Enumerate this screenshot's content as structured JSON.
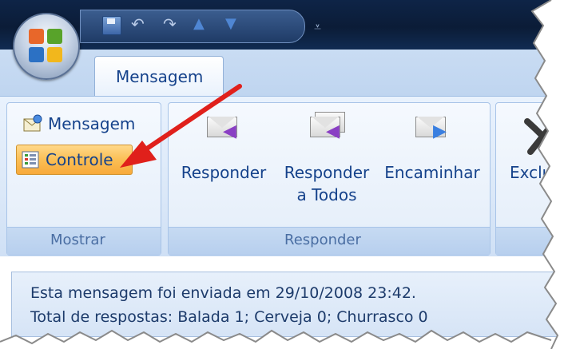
{
  "ribbon": {
    "active_tab": "Mensagem",
    "groups": [
      {
        "label": "Mostrar",
        "buttons": [
          {
            "label": "Mensagem",
            "icon": "message-icon"
          },
          {
            "label": "Controle",
            "icon": "tracking-icon",
            "highlighted": true
          }
        ]
      },
      {
        "label": "Responder",
        "buttons": [
          {
            "label_line1": "Responder",
            "icon": "reply-icon"
          },
          {
            "label_line1": "Responder",
            "label_line2": "a Todos",
            "icon": "reply-all-icon"
          },
          {
            "label_line1": "Encaminhar",
            "icon": "forward-icon"
          }
        ]
      },
      {
        "label": "",
        "buttons": [
          {
            "label_line1": "Exclui",
            "icon": "delete-icon"
          }
        ]
      }
    ]
  },
  "quick_access": [
    "save-icon",
    "undo-icon",
    "redo-icon",
    "previous-item-icon",
    "next-item-icon",
    "customize-icon"
  ],
  "info_bar": {
    "line1": "Esta mensagem foi enviada em 29/10/2008 23:42.",
    "line2": "Total de respostas: Balada 1; Cerveja 0; Churrasco 0"
  },
  "colors": {
    "highlight": "#fbbf55",
    "annotation_arrow": "#e0201b",
    "title_bar": "#0b1c37"
  }
}
